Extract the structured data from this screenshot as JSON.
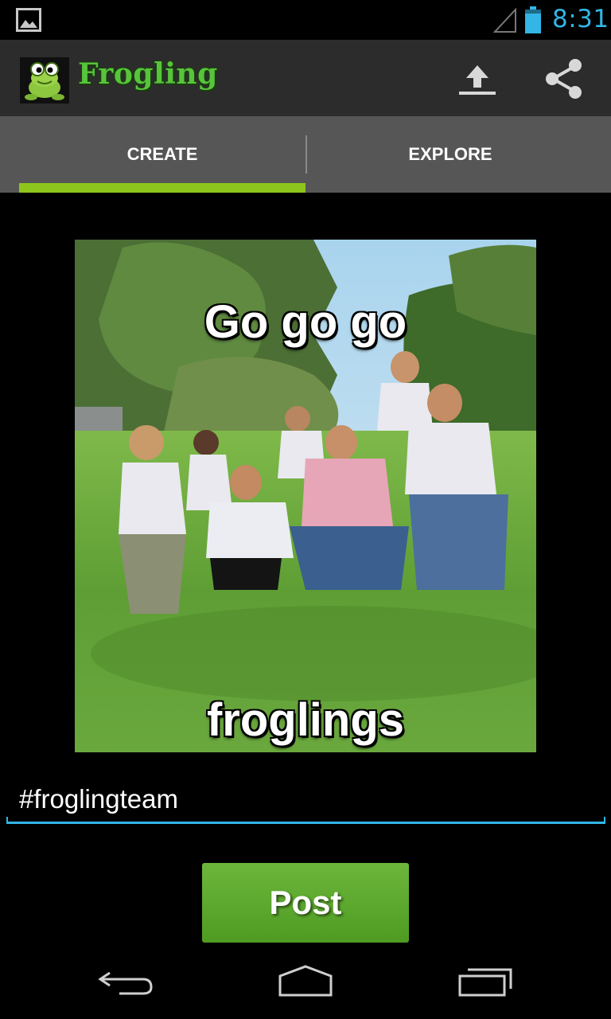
{
  "status_bar": {
    "time": "8:31",
    "icons": [
      "gallery-notification-icon",
      "signal-icon",
      "battery-icon"
    ],
    "accent_color": "#33b5e5"
  },
  "action_bar": {
    "title": "Frogling",
    "logo": "frog-logo",
    "actions": [
      "upload-icon",
      "share-icon"
    ],
    "title_color": "#58c43c"
  },
  "tabs": [
    {
      "label": "CREATE",
      "selected": true
    },
    {
      "label": "EXPLORE",
      "selected": false
    }
  ],
  "tab_indicator_color": "#8ec51c",
  "meme": {
    "top_text": "Go go go",
    "bottom_text": "froglings"
  },
  "caption": {
    "value": "#froglingteam"
  },
  "post_button": {
    "label": "Post",
    "color": "#5aa72c"
  },
  "nav_bar": {
    "icons": [
      "back-icon",
      "home-icon",
      "recent-apps-icon"
    ]
  }
}
